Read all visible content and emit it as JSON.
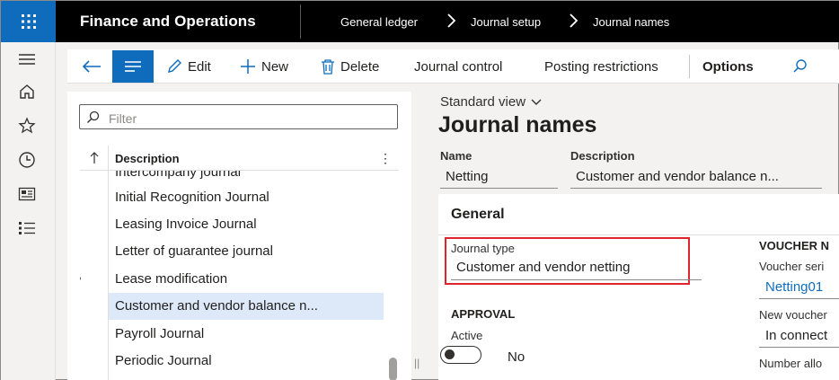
{
  "topbar": {
    "app_title": "Finance and Operations",
    "breadcrumbs": [
      "General ledger",
      "Journal setup",
      "Journal names"
    ]
  },
  "leftnav": {
    "icons": [
      "hamburger-icon",
      "home-icon",
      "star-icon",
      "clock-icon",
      "workspace-icon",
      "list-icon"
    ]
  },
  "actions": {
    "edit": "Edit",
    "new": "New",
    "delete": "Delete",
    "journal_control": "Journal control",
    "posting_restrictions": "Posting restrictions",
    "options": "Options"
  },
  "list": {
    "filter_placeholder": "Filter",
    "column_header": "Description",
    "partial_row": "Intercompany journal",
    "rows": [
      "Initial Recognition Journal",
      "Leasing Invoice Journal",
      "Letter of guarantee journal",
      "Lease modification",
      "Customer and vendor balance n...",
      "Payroll Journal",
      "Periodic Journal"
    ],
    "selected_index": 4
  },
  "detail": {
    "view": "Standard view",
    "title": "Journal names",
    "name_label": "Name",
    "name_value": "Netting",
    "description_label": "Description",
    "description_value": "Customer and vendor balance n...",
    "general_title": "General",
    "journal_type_label": "Journal type",
    "journal_type_value": "Customer and vendor netting",
    "approval_head": "APPROVAL",
    "active_label": "Active",
    "active_value": "No",
    "voucher_head": "VOUCHER N",
    "voucher_series_label": "Voucher seri",
    "voucher_series_value": "Netting01",
    "new_voucher_label": "New voucher",
    "new_voucher_value": "In connect",
    "number_alloc_label": "Number allo"
  },
  "colors": {
    "accent": "#0f6cbd",
    "highlight_box": "#e0242d",
    "selected_row": "#dde8f8"
  }
}
